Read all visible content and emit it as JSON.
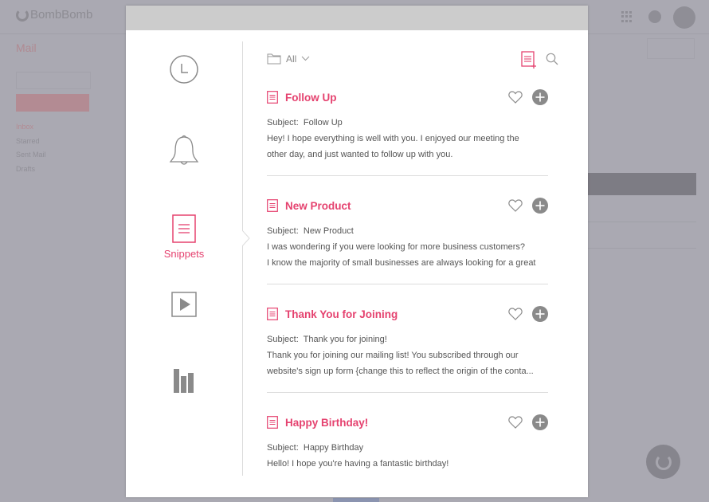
{
  "background_app": {
    "logo_text": "BombBomb",
    "section_title": "Mail",
    "nav": [
      "Inbox",
      "Starred",
      "Sent Mail",
      "Drafts"
    ]
  },
  "colors": {
    "accent": "#e5426f",
    "icon_gray": "#8a8a8a",
    "text": "#555555",
    "overlay_bg": "#aaa9b2"
  },
  "rail": {
    "items": [
      {
        "name": "recent",
        "icon": "clock-icon",
        "label": ""
      },
      {
        "name": "notifications",
        "icon": "bell-icon",
        "label": ""
      },
      {
        "name": "snippets",
        "icon": "document-icon",
        "label": "Snippets",
        "active": true
      },
      {
        "name": "videos",
        "icon": "play-icon",
        "label": ""
      },
      {
        "name": "analytics",
        "icon": "bar-chart-icon",
        "label": ""
      }
    ]
  },
  "toolbar": {
    "folder_filter": "All",
    "folder_icon": "folder-icon",
    "new_snippet_icon": "new-snippet-icon",
    "search_icon": "search-icon"
  },
  "snippets": [
    {
      "title": "Follow Up",
      "subject_label": "Subject:",
      "subject": "Follow Up",
      "body_lines": [
        "Hey! I hope everything is well with you. I enjoyed our meeting the",
        "other day, and just wanted to follow up with you."
      ]
    },
    {
      "title": "New Product",
      "subject_label": "Subject:",
      "subject": "New Product",
      "body_lines": [
        "I was wondering if you were looking for more business customers?",
        "I know the majority of small businesses are always looking for a great"
      ]
    },
    {
      "title": "Thank You for Joining",
      "subject_label": "Subject:",
      "subject": "Thank you for joining!",
      "body_lines": [
        "Thank you for joining our mailing list! You subscribed through our",
        "website's sign up form {change this to reflect the origin of the conta..."
      ]
    },
    {
      "title": "Happy Birthday!",
      "subject_label": "Subject:",
      "subject": "Happy Birthday",
      "body_lines": [
        "Hello! I hope you're having a fantastic birthday!"
      ]
    }
  ]
}
